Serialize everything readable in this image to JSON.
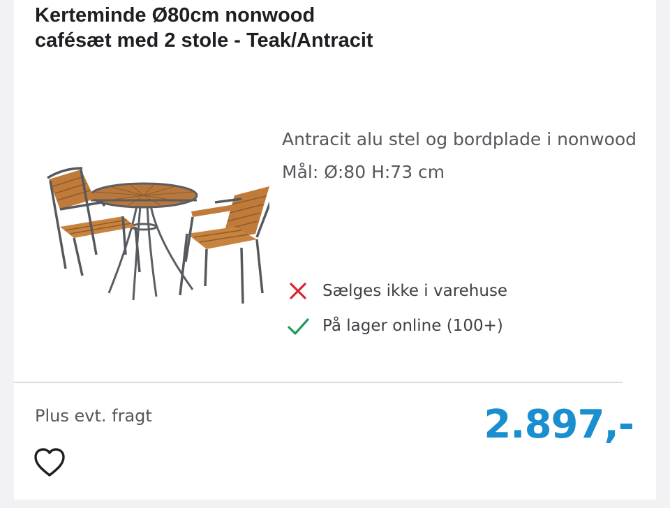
{
  "product": {
    "title_line1": "Kerteminde Ø80cm nonwood",
    "title_line2": "cafésæt med 2 stole - Teak/Antracit",
    "desc_line1": "Antracit alu stel og bordplade i nonwood",
    "desc_line2": "Mål: Ø:80 H:73 cm",
    "image_icon": "patio-table-chairs-image"
  },
  "availability": [
    {
      "text": "Sælges ikke i varehuse",
      "icon": "cross-icon",
      "color": "#d6262b"
    },
    {
      "text": "På lager online (100+)",
      "icon": "check-icon",
      "color": "#1f9a5b"
    }
  ],
  "footer": {
    "shipping": "Plus evt. fragt",
    "price": "2.897,-",
    "favorite_icon": "heart-icon"
  },
  "colors": {
    "price": "#1a8fd0",
    "background": "#f2f2f4"
  }
}
